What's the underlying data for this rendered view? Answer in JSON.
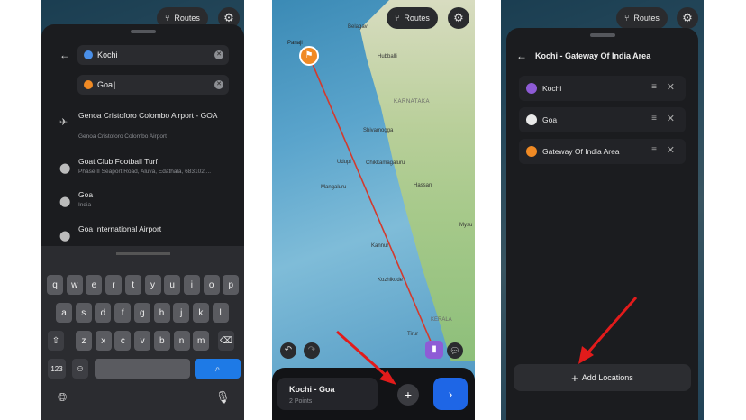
{
  "routes_label": "Routes",
  "panel1": {
    "from": "Kochi",
    "to": "Goa",
    "results": [
      {
        "title": "Genoa Cristoforo Colombo Airport - GOA",
        "subtitle": "Genoa Cristoforo Colombo Airport",
        "icon": "airplane-icon"
      },
      {
        "title": "Goat Club Football Turf",
        "subtitle": "Phase II Seaport Road, Aluva, Edathala, 683102,...",
        "icon": "pin-icon"
      },
      {
        "title": "Goa",
        "subtitle": "India",
        "icon": "pin-icon"
      },
      {
        "title": "Goa International Airport",
        "subtitle": "",
        "icon": "pin-icon"
      }
    ],
    "kb_row1": [
      "q",
      "w",
      "e",
      "r",
      "t",
      "y",
      "u",
      "i",
      "o",
      "p"
    ],
    "kb_row2": [
      "a",
      "s",
      "d",
      "f",
      "g",
      "h",
      "j",
      "k",
      "l"
    ],
    "kb_row3": [
      "z",
      "x",
      "c",
      "v",
      "b",
      "n",
      "m"
    ],
    "kb_123": "123"
  },
  "panel2": {
    "cities": [
      "Panaji",
      "Belagavi",
      "Hubballi",
      "KARNATAKA",
      "Shivamogga",
      "Udupi",
      "Chikkamagaluru",
      "Mangaluru",
      "Hassan",
      "Kannur",
      "Kozhikode",
      "Mysu",
      "KERALA",
      "Tirur"
    ],
    "route_title": "Kochi - Goa",
    "route_points": "2 Points"
  },
  "panel3": {
    "title": "Kochi - Gateway Of India Area",
    "locations": [
      {
        "name": "Kochi",
        "color": "#8e5bd6"
      },
      {
        "name": "Goa",
        "color": "#e9e9e9"
      },
      {
        "name": "Gateway Of India Area",
        "color": "#f08a24"
      }
    ],
    "add_label": "Add Locations"
  }
}
